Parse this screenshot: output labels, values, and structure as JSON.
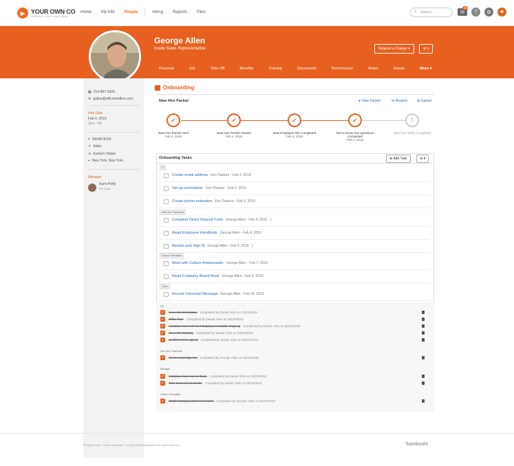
{
  "app": {
    "logo_main": "YOUR OWN CO",
    "logo_sub": "COMPANY LOGO GOES HERE",
    "nav": [
      "Home",
      "My Info",
      "People",
      "Hiring",
      "Reports",
      "Files"
    ],
    "search_placeholder": "Search...",
    "notifications_count": "24",
    "accent_color": "#e8601f",
    "link_color": "#2a6ab5"
  },
  "employee": {
    "name": "George Allen",
    "role": "Inside Sales Representative",
    "request_change": "Request a Change ▾",
    "gear": "⚙ ▾",
    "tabs": [
      "Personal",
      "Job",
      "Time Off",
      "Benefits",
      "Training",
      "Documents",
      "Performance",
      "Notes",
      "Assets",
      "More ▾"
    ]
  },
  "sidebar": {
    "phone": "214-867-5309",
    "email": "gallen@efficientoffice.com",
    "hire_label": "Hire Date",
    "hire_date": "Feb 4, 2019",
    "tenure": "11m - 4d",
    "emp_id": "5454878754",
    "dept": "Sales",
    "division": "Eastern States",
    "location": "New York, New York",
    "manager_label": "Manager",
    "manager_name": "Karin Petty",
    "manager_title": "VP, Sales"
  },
  "onboarding": {
    "title": "Onboarding",
    "packet_title": "New Hire Packet",
    "view_packet": "View Packet",
    "resend": "Resend",
    "cancel": "Cancel",
    "steps": [
      {
        "label": "New Hire Packet Sent",
        "date": "Feb 4, 2019",
        "state": "done"
      },
      {
        "label": "New Hire Packet Viewed",
        "date": "Feb 4, 2019",
        "state": "done"
      },
      {
        "label": "New Employee Info Completed",
        "date": "Feb 4, 2019",
        "state": "done"
      },
      {
        "label": "Get to Know You Questions Completed",
        "date": "Feb 4, 2019",
        "state": "done"
      },
      {
        "label": "New Hire Tasks Completed",
        "date": "",
        "state": "pending",
        "number": "5"
      }
    ],
    "tasks_title": "Onboarding Tasks",
    "add_task": "Add Task",
    "groups": [
      {
        "tag": "IT",
        "tasks": [
          {
            "title": "Create email address",
            "meta": "Eric Pasture - Feb 3, 2019"
          },
          {
            "title": "Set up workstation",
            "meta": "Eric Pasture - Feb 2, 2019"
          },
          {
            "title": "Create phone extension",
            "meta": "Eric Pasture - Feb 3, 2019"
          }
        ]
      },
      {
        "tag": "New Hire Paperwork",
        "tasks": [
          {
            "title": "Complete Direct Deposit Form",
            "meta": "George Allen - Feb 4, 2019"
          },
          {
            "title": "Read Employee Handbook",
            "meta": "George Allen - Feb 4, 2019"
          },
          {
            "title": "Review and Sign I9",
            "meta": "George Allen - Feb 4, 2019"
          }
        ]
      },
      {
        "tag": "Culture Orientation",
        "tasks": [
          {
            "title": "Meet with Culture Ambassador",
            "meta": "George Allen - Feb 7, 2019"
          },
          {
            "title": "Read Company Brand Book",
            "meta": "George Allen - Feb 9, 2019"
          }
        ]
      },
      {
        "tag": "Other",
        "tasks": [
          {
            "title": "Record Voicemail Message",
            "meta": "George Allen - Feb 18, 2019"
          }
        ]
      }
    ],
    "completed_groups": [
      {
        "tag": "HR",
        "tasks": [
          {
            "title": "New Hire Orientation",
            "meta": "Completed by Daniel John on 03/22/2019"
          },
          {
            "title": "Office Tour",
            "meta": "Completed by Daniel John on 03/22/2019"
          },
          {
            "title": "Introduce New Hire to 2 Employees outside of group",
            "meta": "Completed by Daniel John on 03/22/2019"
          },
          {
            "title": "New Hire Training",
            "meta": "Completed by Daniel John on 03/22/2019"
          },
          {
            "title": "Confirm W4 is signed",
            "meta": "Completed by Daniel John on 03/22/2019"
          }
        ]
      },
      {
        "tag": "New Hire Paperwork",
        "tasks": [
          {
            "title": "Review and Sign W4",
            "meta": "Completed by George Allen on 02/04/2019"
          }
        ]
      },
      {
        "tag": "Manager",
        "tasks": [
          {
            "title": "Introduce New Hire to Team",
            "meta": "Completed by Daniel John on 03/22/2019"
          },
          {
            "title": "Take New Hire to lunch!!",
            "meta": "Completed by Daniel John on 03/22/2019"
          }
        ]
      },
      {
        "tag": "Culture Orientation",
        "tasks": [
          {
            "title": "Watch Company Overview Video",
            "meta": "Completed by George Allen on 02/04/2019"
          }
        ]
      }
    ]
  },
  "footer": {
    "text": "Privacy Policy · Terms of Service · © 2008-2020 BambooHR All rights reserved",
    "brand": "°bamboohr"
  }
}
